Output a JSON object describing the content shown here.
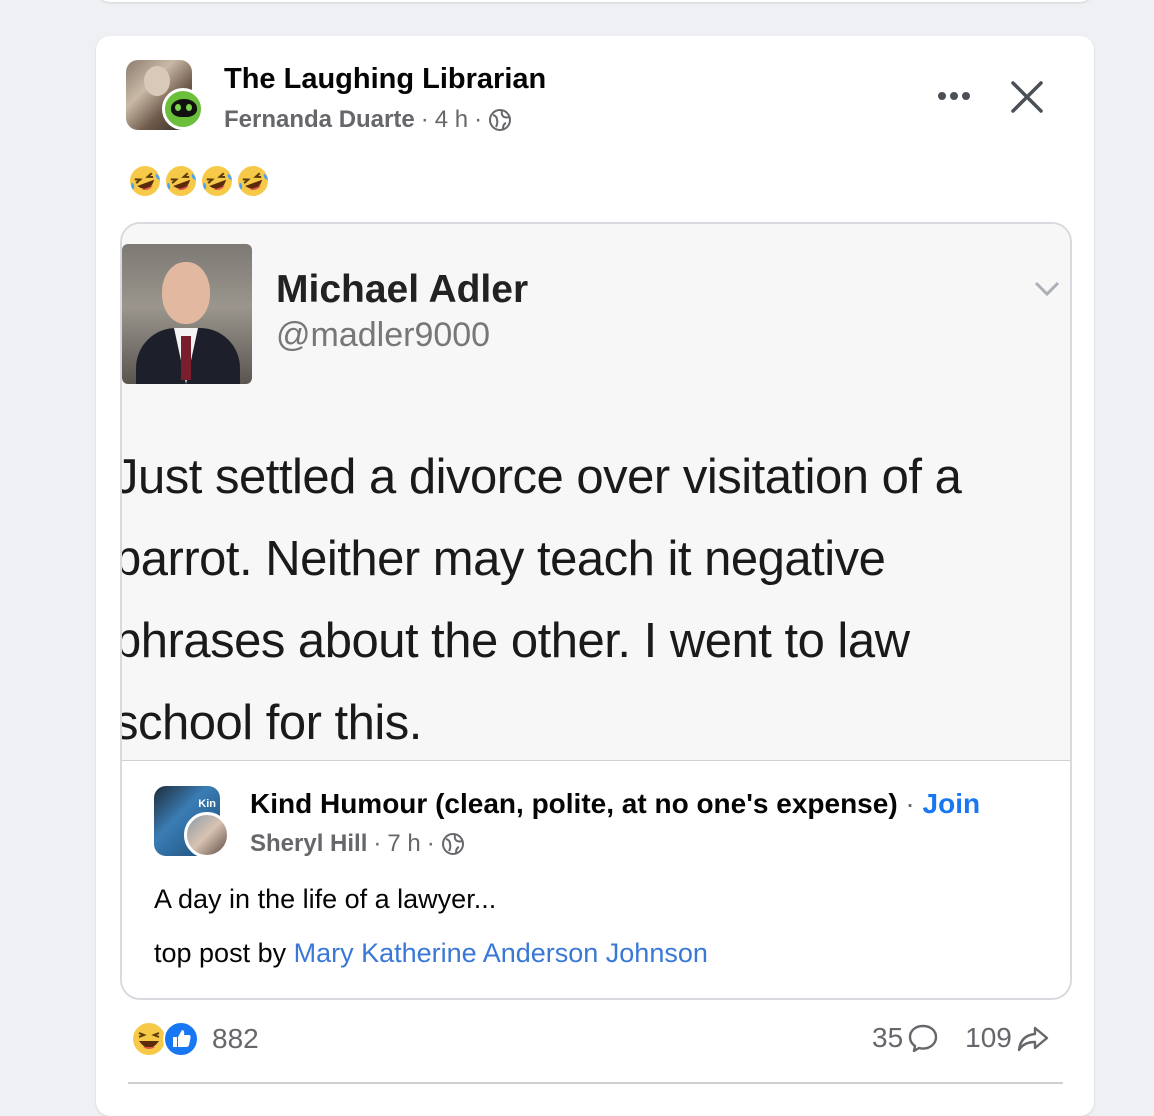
{
  "post": {
    "group_name": "The Laughing Librarian",
    "author": "Fernanda Duarte",
    "time": "4 h",
    "separator": "·",
    "emoji_text": "🤣🤣🤣🤣",
    "emoji_count": 4,
    "more_icon": "more-horizontal-icon",
    "close_icon": "close-icon"
  },
  "tweet": {
    "name": "Michael Adler",
    "handle": "@madler9000",
    "lines": [
      "Just settled a divorce over visitation of a",
      "parrot. Neither may teach it negative",
      "phrases about the other. I went to law",
      "school for this."
    ]
  },
  "source": {
    "group_name": "Kind Humour (clean, polite, at no one's expense)",
    "dot": "·",
    "join": "Join",
    "author": "Sheryl Hill",
    "time": "7 h",
    "avatar_text": "Kin",
    "caption": "A day in the life of a lawyer...",
    "top_post_prefix": "top post by",
    "top_post_author": "Mary Katherine Anderson Johnson"
  },
  "footer": {
    "reaction_count": "882",
    "comments": "35",
    "shares": "109"
  },
  "colors": {
    "accent": "#1877f2",
    "link": "#3a78d6",
    "muted": "#65676b",
    "background": "#eef0f3"
  }
}
